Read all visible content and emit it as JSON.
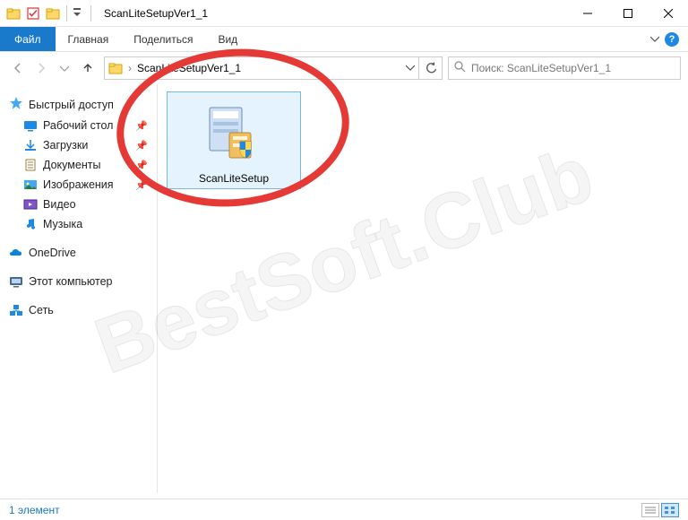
{
  "titlebar": {
    "title": "ScanLiteSetupVer1_1"
  },
  "ribbon": {
    "file": "Файл",
    "tabs": [
      "Главная",
      "Поделиться",
      "Вид"
    ]
  },
  "breadcrumb": {
    "current": "ScanLiteSetupVer1_1"
  },
  "search": {
    "placeholder": "Поиск: ScanLiteSetupVer1_1"
  },
  "sidebar": {
    "quick_access": "Быстрый доступ",
    "items": [
      {
        "label": "Рабочий стол",
        "pinned": true
      },
      {
        "label": "Загрузки",
        "pinned": true
      },
      {
        "label": "Документы",
        "pinned": true
      },
      {
        "label": "Изображения",
        "pinned": true
      },
      {
        "label": "Видео",
        "pinned": false
      },
      {
        "label": "Музыка",
        "pinned": false
      }
    ],
    "onedrive": "OneDrive",
    "this_pc": "Этот компьютер",
    "network": "Сеть"
  },
  "content": {
    "files": [
      {
        "label": "ScanLiteSetup"
      }
    ]
  },
  "statusbar": {
    "count": "1 элемент"
  },
  "watermark": "BestSoft.Club"
}
